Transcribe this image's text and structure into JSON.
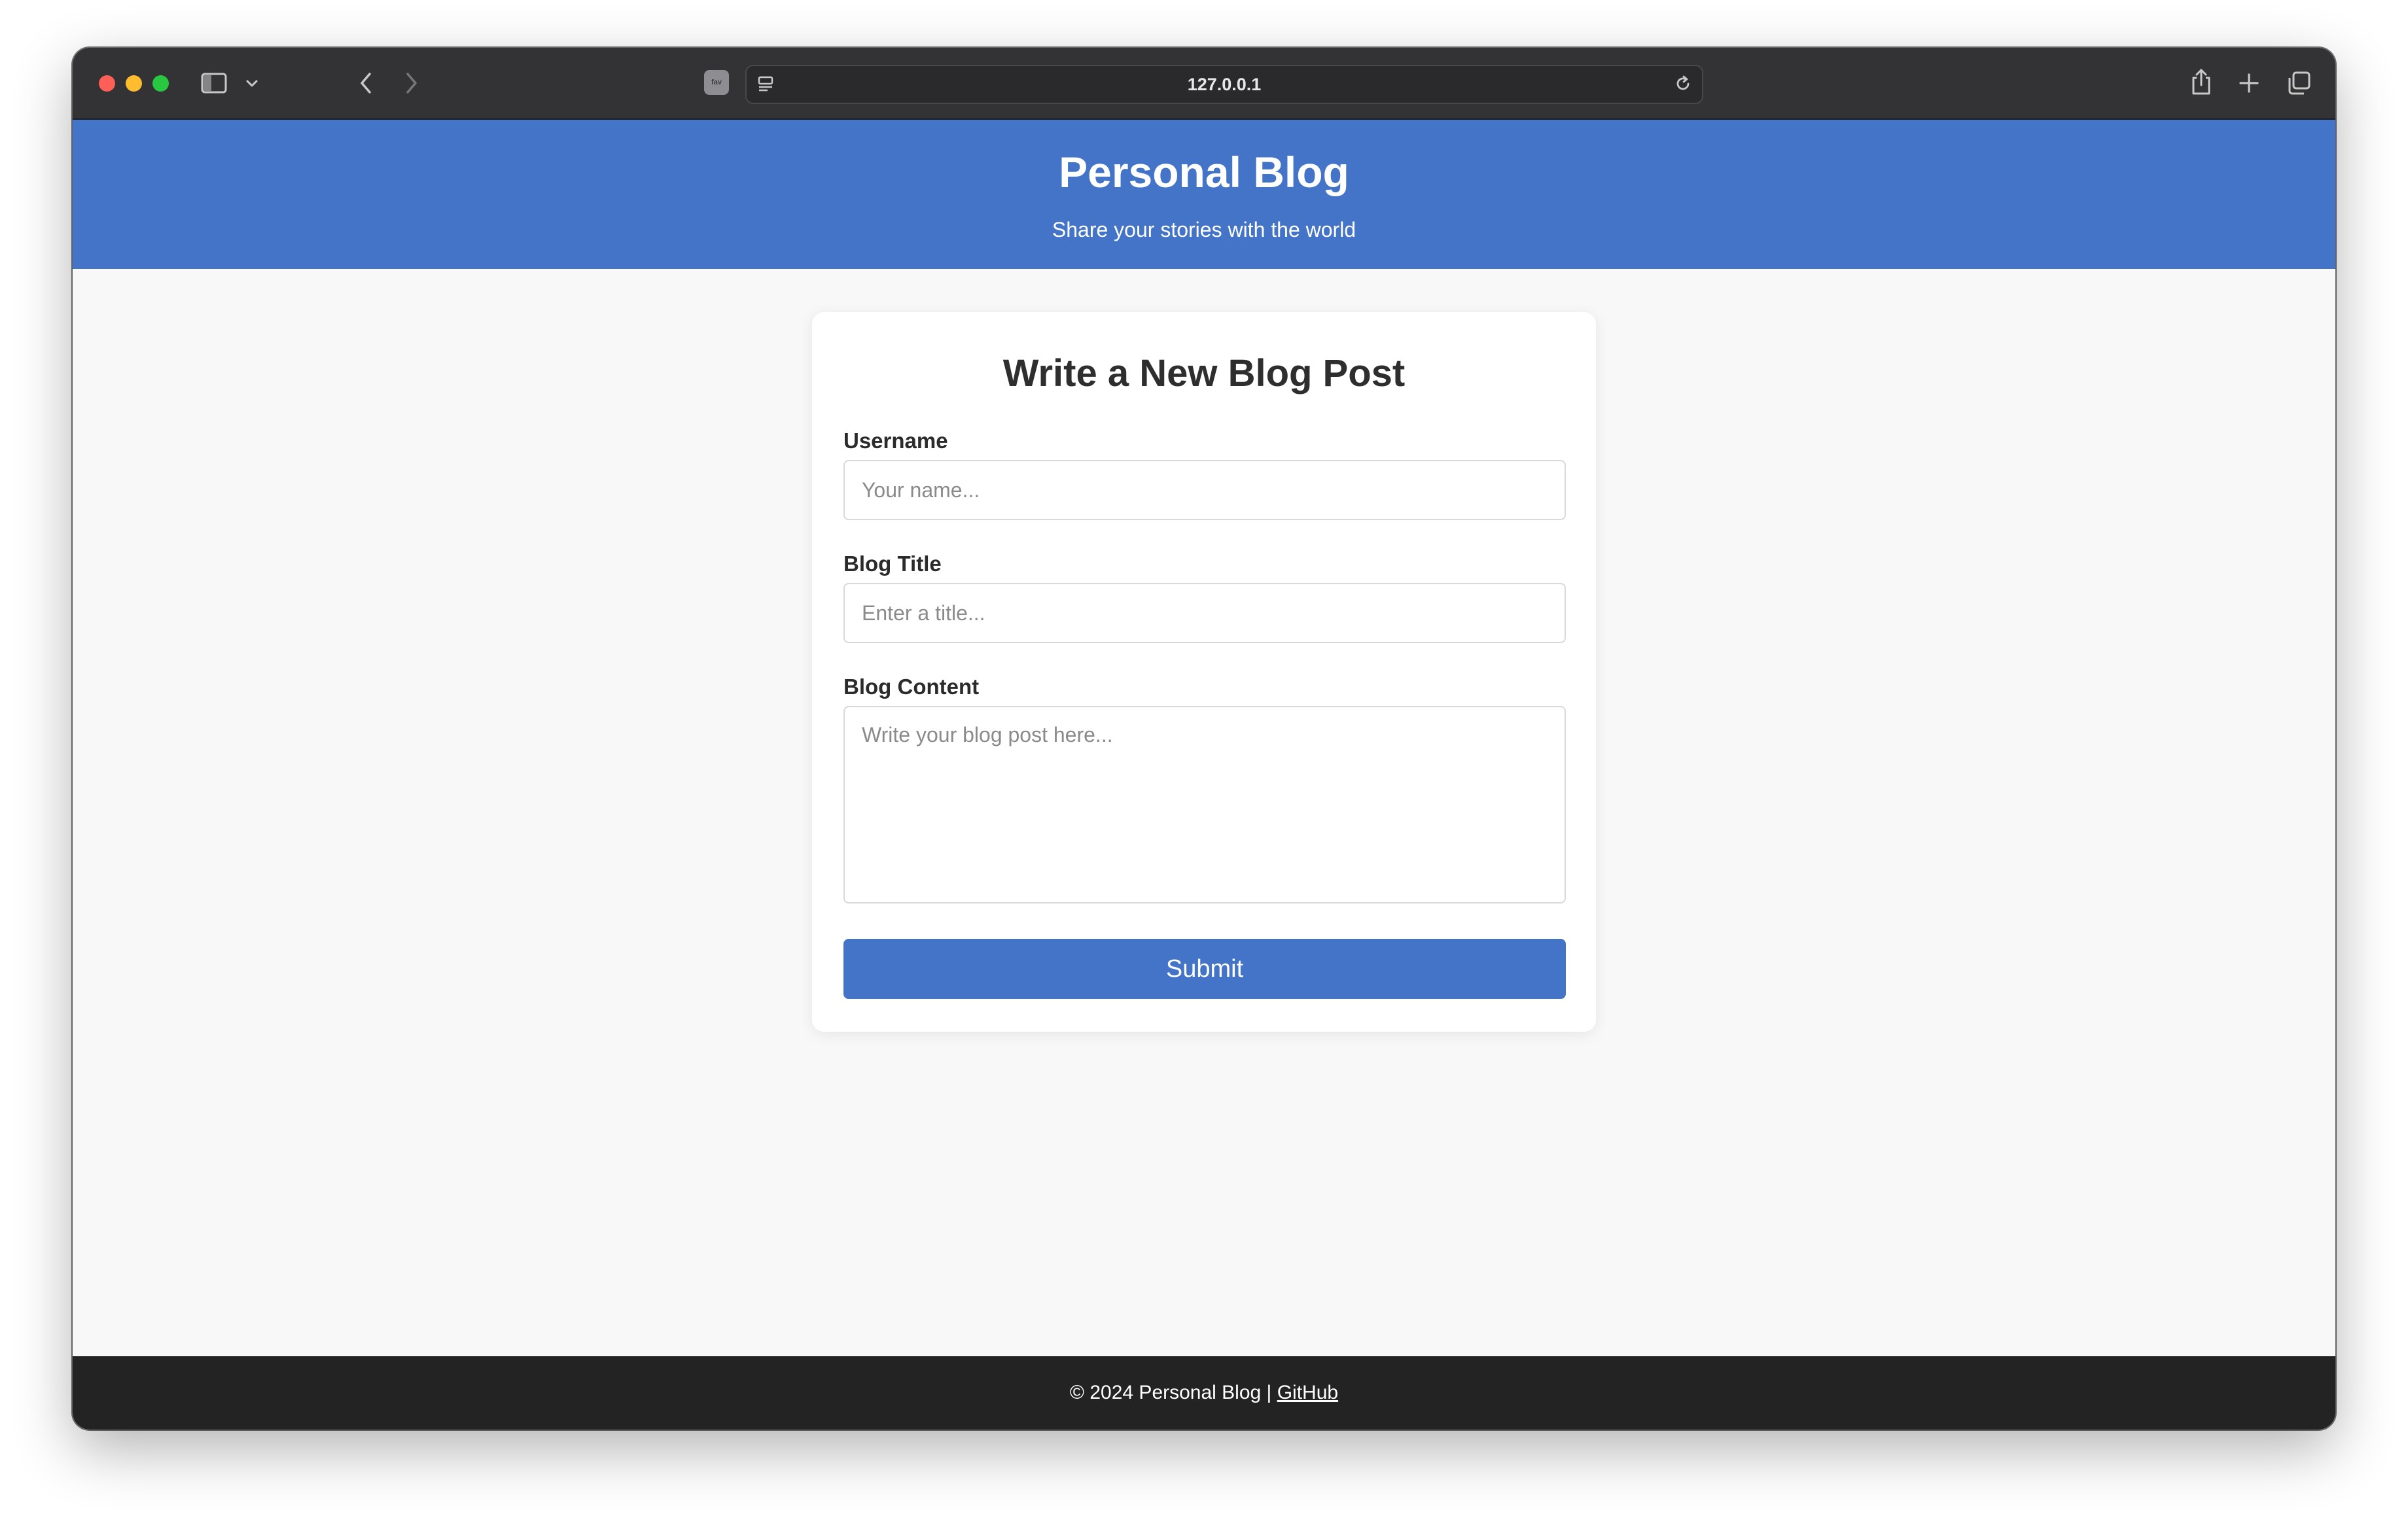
{
  "browser": {
    "url": "127.0.0.1",
    "tab_favicon_text": "fav",
    "icons": [
      "sidebar-icon",
      "chevron-down-icon",
      "back-icon",
      "forward-icon",
      "reader-icon",
      "reload-icon",
      "share-icon",
      "new-tab-icon",
      "tabs-overview-icon"
    ]
  },
  "header": {
    "title": "Personal Blog",
    "tagline": "Share your stories with the world"
  },
  "form": {
    "heading": "Write a New Blog Post",
    "username_label": "Username",
    "username_placeholder": "Your name...",
    "username_value": "",
    "title_label": "Blog Title",
    "title_placeholder": "Enter a title...",
    "title_value": "",
    "content_label": "Blog Content",
    "content_placeholder": "Write your blog post here...",
    "content_value": "",
    "submit_label": "Submit"
  },
  "footer": {
    "copyright": "© 2024 Personal Blog | ",
    "link_label": "GitHub"
  },
  "colors": {
    "accent": "#4474c8",
    "footer_bg": "#232323",
    "page_bg": "#f8f8f8"
  }
}
